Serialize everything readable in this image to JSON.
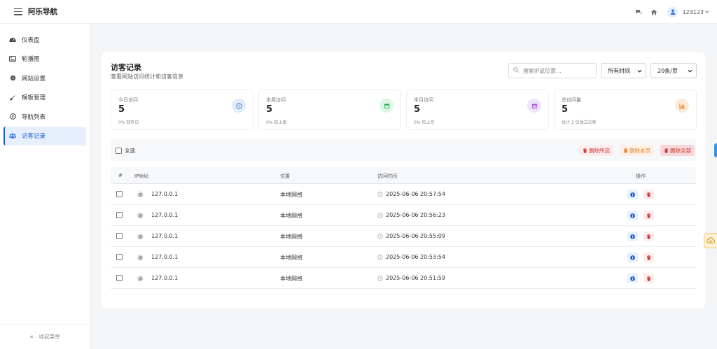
{
  "header": {
    "brand": "阿乐导航",
    "username": "123123"
  },
  "sidebar": {
    "items": [
      {
        "label": "仪表盘",
        "icon": "dashboard-icon"
      },
      {
        "label": "轮播图",
        "icon": "image-icon"
      },
      {
        "label": "网站设置",
        "icon": "gear-icon"
      },
      {
        "label": "模板管理",
        "icon": "brush-icon"
      },
      {
        "label": "导航列表",
        "icon": "compass-icon"
      },
      {
        "label": "访客记录",
        "icon": "users-icon",
        "active": true
      }
    ],
    "collapse_label": "收起菜单"
  },
  "page": {
    "title": "访客记录",
    "subtitle": "查看网站访问统计和访客信息",
    "search_placeholder": "搜索IP或位置...",
    "time_filter": "所有时间",
    "page_size": "20条/页"
  },
  "stats": [
    {
      "label": "今日访问",
      "value": "5",
      "note": "0% 较昨日",
      "icon": "clock-icon",
      "color": "#4a7fe0",
      "bg": "#e3ecfb"
    },
    {
      "label": "本周访问",
      "value": "5",
      "note": "0% 较上周",
      "icon": "calendar-week-icon",
      "color": "#2eaa5c",
      "bg": "#dcf5e5"
    },
    {
      "label": "本月访问",
      "value": "5",
      "note": "0% 较上月",
      "icon": "calendar-month-icon",
      "color": "#9b59d0",
      "bg": "#efe3f9"
    },
    {
      "label": "总访问量",
      "value": "5",
      "note": "总计 1 位独立访客",
      "icon": "bar-chart-icon",
      "color": "#e67e22",
      "bg": "#fdebd8"
    }
  ],
  "actions": {
    "select_all": "全选",
    "delete_selected": "删除所选",
    "delete_page": "删除本页",
    "delete_all": "删除全部"
  },
  "table": {
    "headers": {
      "index": "#",
      "ip": "IP地址",
      "location": "位置",
      "time": "访问时间",
      "ops": "操作"
    },
    "rows": [
      {
        "ip": "127.0.0.1",
        "location": "本地网络",
        "time": "2025-06-06 20:57:54"
      },
      {
        "ip": "127.0.0.1",
        "location": "本地网络",
        "time": "2025-06-06 20:56:23"
      },
      {
        "ip": "127.0.0.1",
        "location": "本地网络",
        "time": "2025-06-06 20:55:09"
      },
      {
        "ip": "127.0.0.1",
        "location": "本地网络",
        "time": "2025-06-06 20:53:54"
      },
      {
        "ip": "127.0.0.1",
        "location": "本地网络",
        "time": "2025-06-06 20:51:59"
      }
    ]
  },
  "colors": {
    "accent": "#1f5fd6",
    "danger": "#d63031",
    "warning": "#e67e22"
  }
}
